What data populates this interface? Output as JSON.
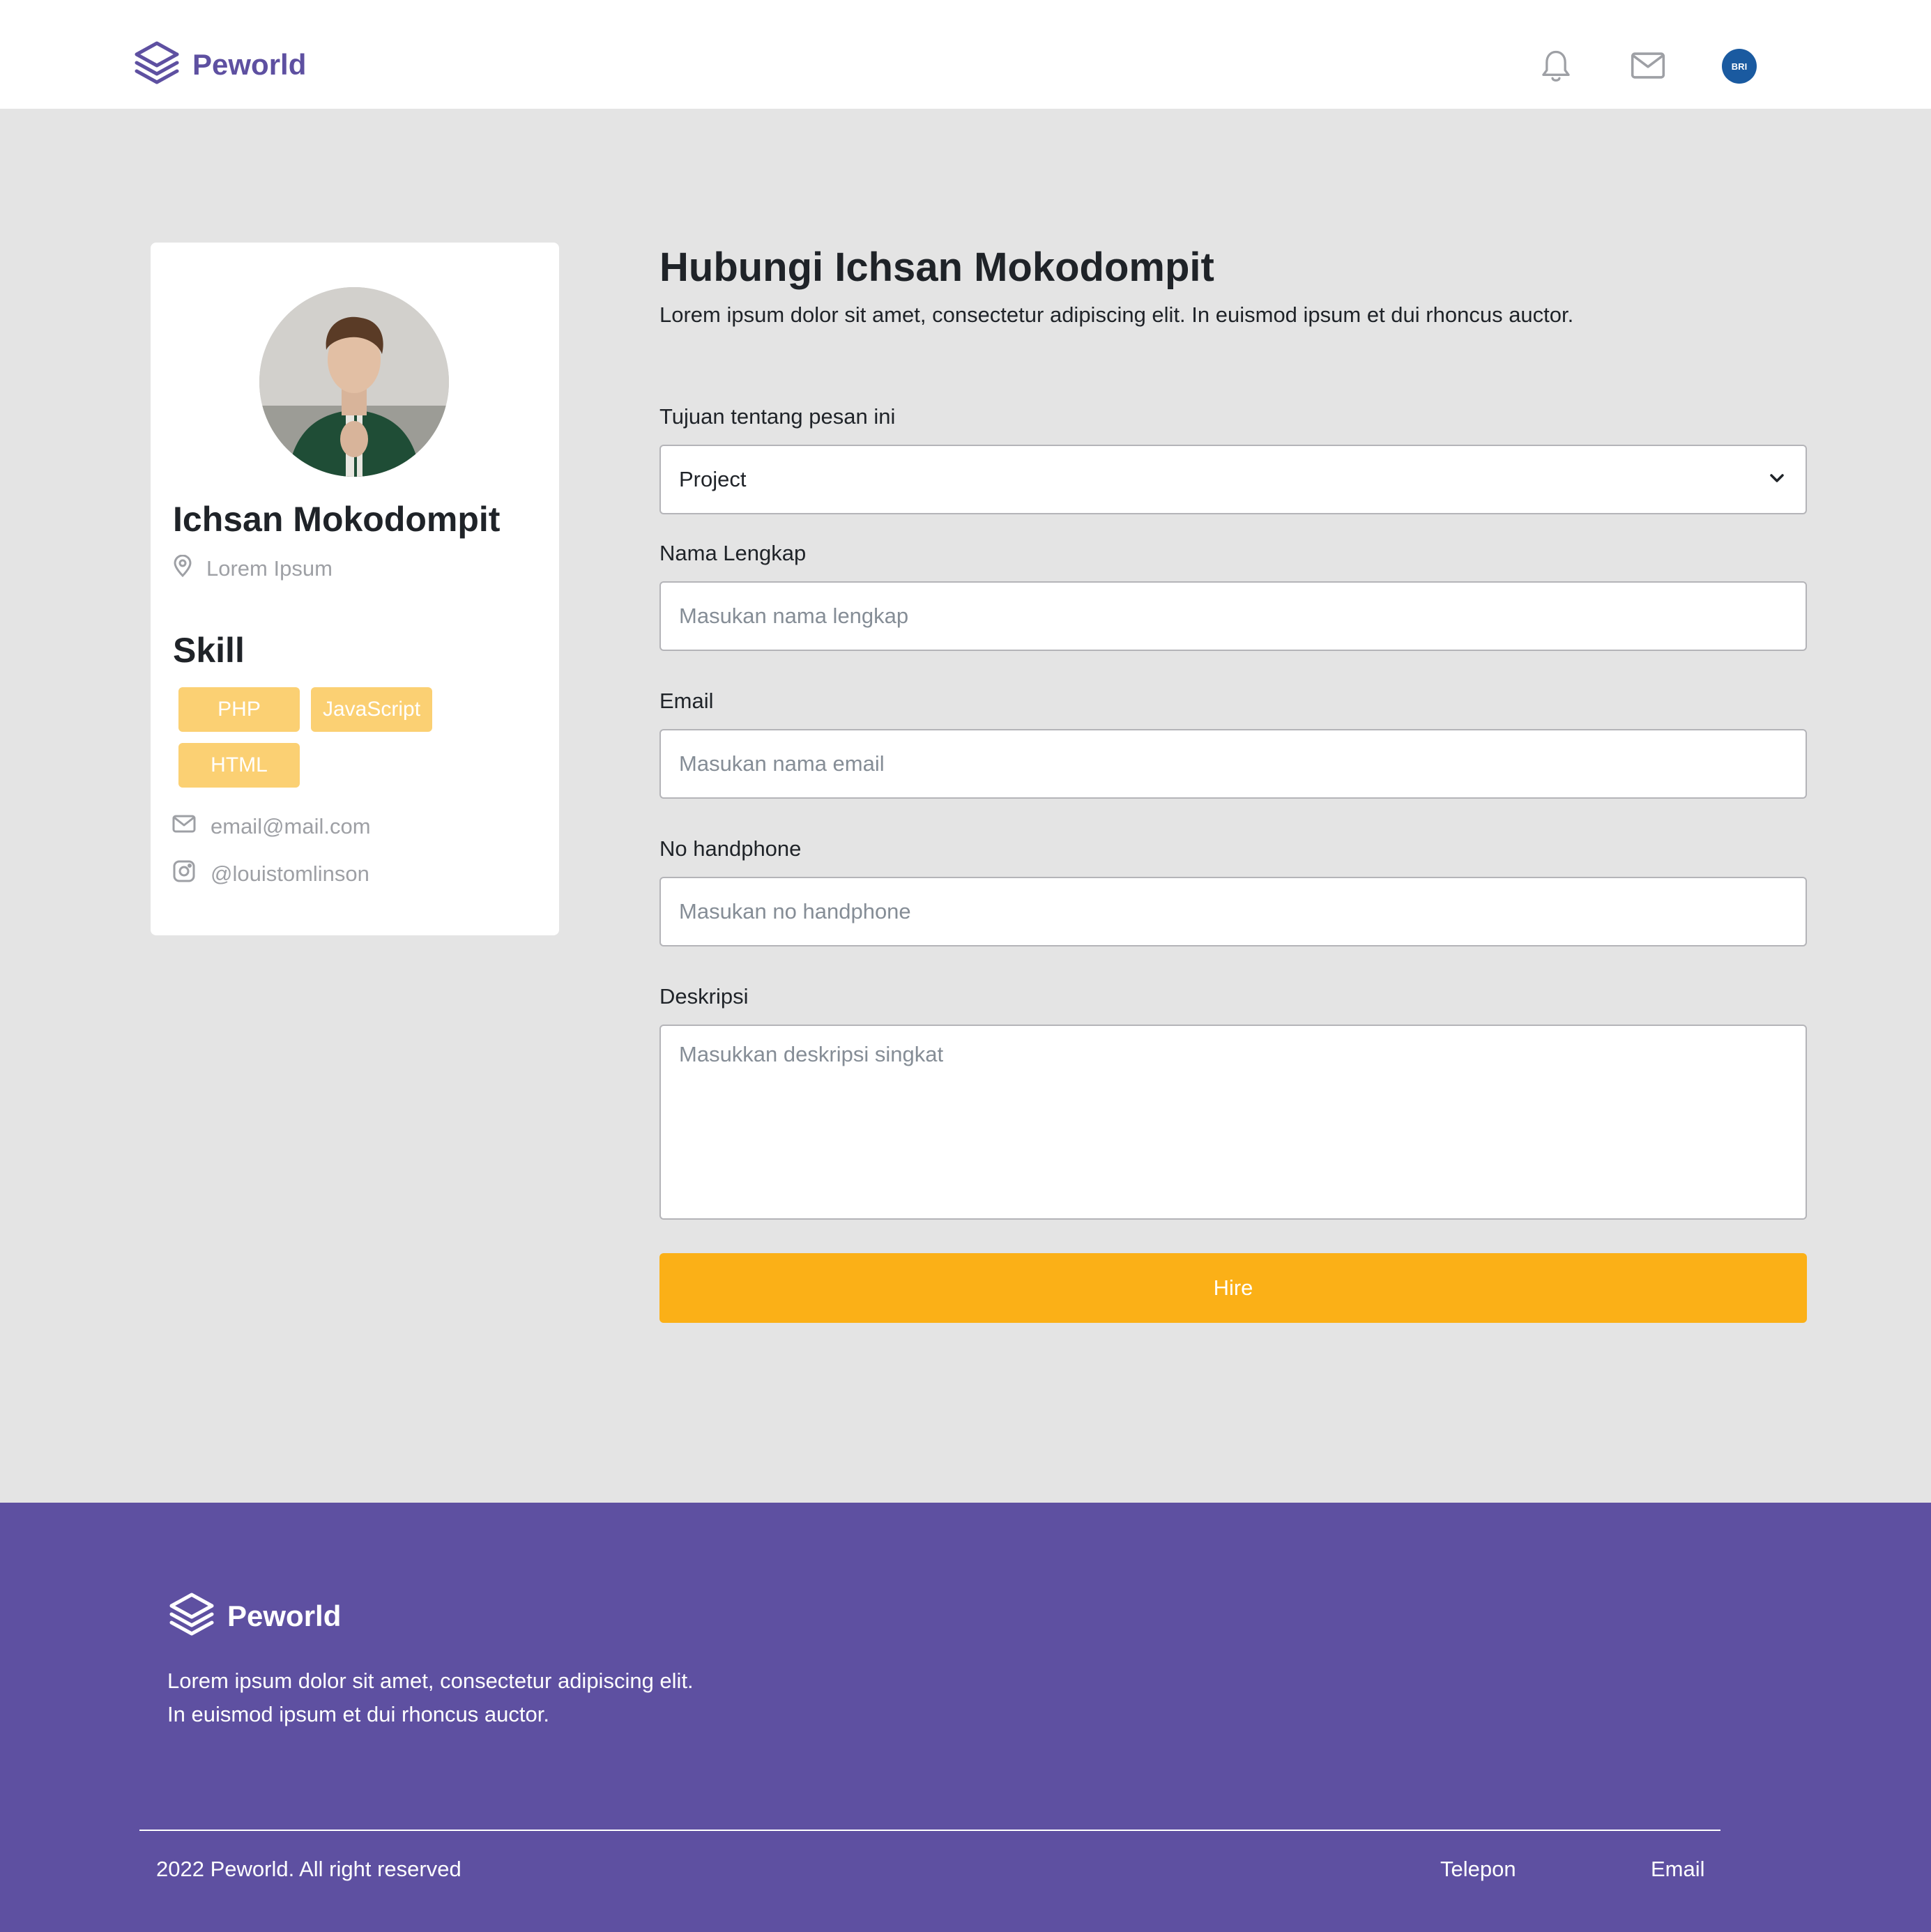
{
  "navbar": {
    "brand": "Peworld",
    "avatar_text": "BRI",
    "icons": [
      "layers-logo-icon",
      "bell-icon",
      "mail-icon",
      "avatar"
    ]
  },
  "profile": {
    "name": "Ichsan Mokodompit",
    "location": "Lorem Ipsum",
    "skill_title": "Skill",
    "skills": [
      "PHP",
      "JavaScript",
      "HTML"
    ],
    "email": "email@mail.com",
    "instagram": "@louistomlinson"
  },
  "form": {
    "title": "Hubungi Ichsan Mokodompit",
    "subtitle": "Lorem ipsum dolor sit amet, consectetur adipiscing elit. In euismod ipsum et dui rhoncus auctor.",
    "purpose": {
      "label": "Tujuan tentang pesan ini",
      "value": "Project"
    },
    "name": {
      "label": "Nama Lengkap",
      "placeholder": "Masukan nama lengkap"
    },
    "email": {
      "label": "Email",
      "placeholder": "Masukan nama email"
    },
    "phone": {
      "label": "No handphone",
      "placeholder": "Masukan no handphone"
    },
    "description": {
      "label": "Deskripsi",
      "placeholder": "Masukkan deskripsi singkat"
    },
    "submit_label": "Hire"
  },
  "footer": {
    "brand": "Peworld",
    "description": "Lorem ipsum dolor sit amet, consectetur adipiscing elit. In euismod ipsum et dui rhoncus auctor.",
    "copyright": "2022 Peworld. All right reserved",
    "links": [
      "Telepon",
      "Email"
    ]
  },
  "colors": {
    "brand_purple": "#5e50a1",
    "accent_yellow": "#fbb017",
    "tag_yellow": "#fbd073",
    "page_background": "#e4e4e4"
  }
}
